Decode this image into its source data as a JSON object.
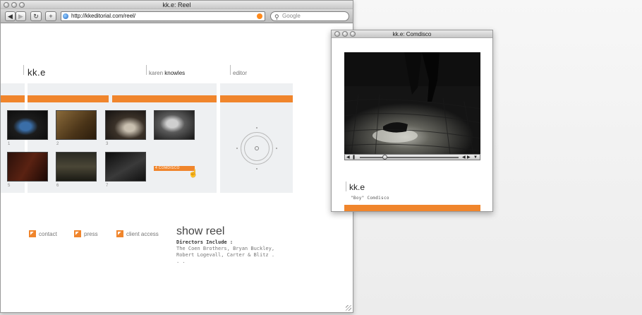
{
  "browser": {
    "title": "kk.e: Reel",
    "url": "http://kkeditorial.com/reel/",
    "search_placeholder": "Google"
  },
  "site": {
    "logo": "kk.e",
    "name_first": "karen",
    "name_last": "knowles",
    "role": "editor",
    "thumbnail_numbers": [
      "1",
      "2",
      "3",
      "5",
      "6",
      "7"
    ],
    "selected_label": "4 COMDISCO",
    "nav": [
      "contact",
      "press",
      "client access"
    ],
    "heading": "show reel",
    "directors_heading": "Directors Include :",
    "directors_text": "The Coen Brothers, Bryan Buckley, Robert Logevall, Carter & Blitz . . .",
    "accent_color": "#f0852c"
  },
  "popup": {
    "title": "kk.e: Comdisco",
    "logo": "kk.e",
    "caption": "\"Boy\" Comdisco",
    "playback_progress": 0.25
  },
  "icons": [
    "back-icon",
    "forward-icon",
    "reload-icon",
    "add-bookmark-icon",
    "globe-icon",
    "rss-icon",
    "search-icon",
    "pointer-cursor-icon",
    "play-icon",
    "volume-icon",
    "menu-icon"
  ]
}
